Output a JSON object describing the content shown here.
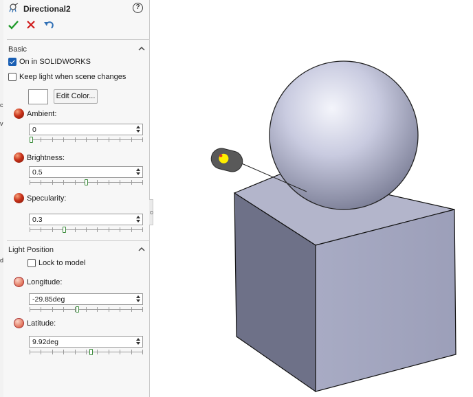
{
  "gutter": [
    "c",
    "v",
    "d"
  ],
  "panel": {
    "title": "Directional2",
    "help_glyph": "?",
    "actions": {
      "ok_icon": "green-checkmark-icon",
      "cancel_icon": "red-x-icon",
      "undo_icon": "undo-icon"
    }
  },
  "basic": {
    "header": "Basic",
    "on_in_solidworks": {
      "label": "On in SOLIDWORKS",
      "checked": true
    },
    "keep_light": {
      "label": "Keep light when scene changes",
      "checked": false
    },
    "edit_color_label": "Edit Color...",
    "ambient": {
      "label": "Ambient:",
      "value": "0",
      "slider_fraction": 0.0
    },
    "brightness": {
      "label": "Brightness:",
      "value": "0.5",
      "slider_fraction": 0.5
    },
    "specularity": {
      "label": "Specularity:",
      "value": "0.3",
      "slider_fraction": 0.3
    }
  },
  "light_position": {
    "header": "Light Position",
    "lock_to_model": {
      "label": "Lock to model",
      "checked": false
    },
    "longitude": {
      "label": "Longitude:",
      "value": "-29.85deg",
      "slider_fraction": 0.42
    },
    "latitude": {
      "label": "Latitude:",
      "value": "9.92deg",
      "slider_fraction": 0.55
    }
  },
  "colors": {
    "panel_bg": "#f7f7f7",
    "accent_blue": "#1a5fb4",
    "ok_green": "#1f9a2a",
    "cancel_red": "#d01c1c",
    "model_face": "#a9acc4",
    "light_marker": "#ffee00"
  }
}
